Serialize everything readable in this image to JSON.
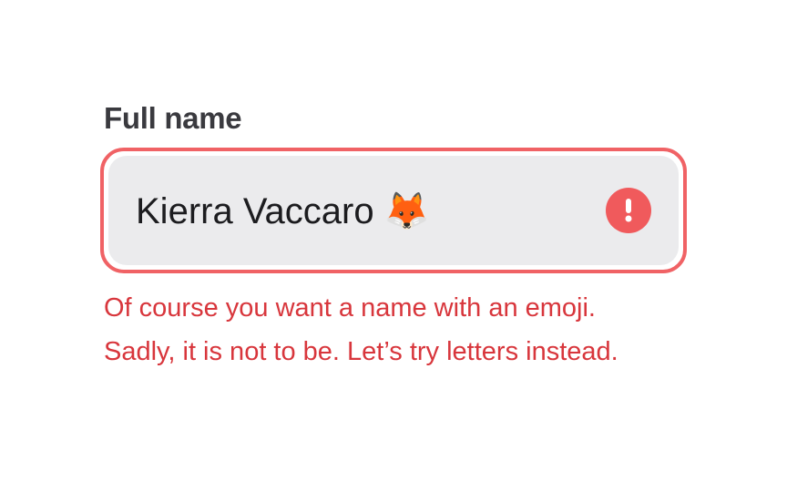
{
  "form": {
    "label": "Full name",
    "input_value": "Kierra Vaccaro 🦊",
    "error_message_line1": "Of course you want a name with an emoji.",
    "error_message_line2": "Sadly, it is not to be. Let’s try letters instead."
  },
  "colors": {
    "error_border": "#f06265",
    "error_icon": "#f05a5c",
    "error_text": "#d8363c",
    "input_background": "#ebebed",
    "label_text": "#3a3a3f"
  },
  "icons": {
    "error": "exclamation-circle-icon"
  }
}
